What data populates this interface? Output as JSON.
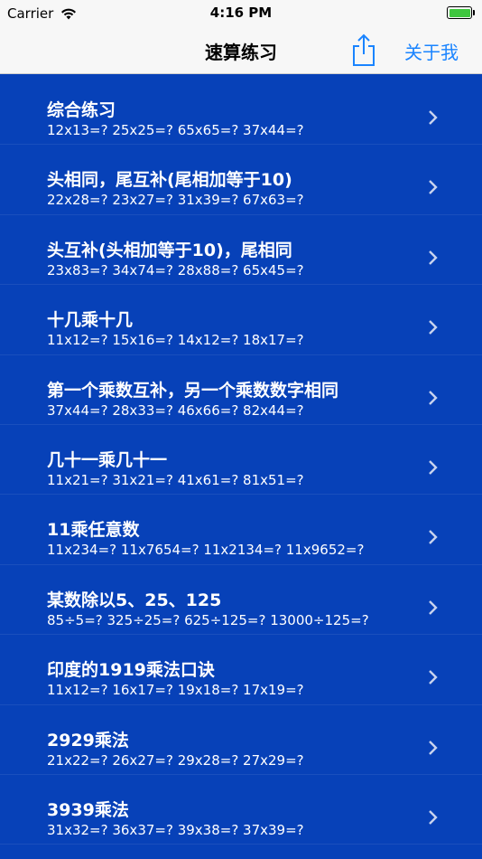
{
  "status": {
    "carrier": "Carrier",
    "time": "4:16 PM"
  },
  "nav": {
    "title": "速算练习",
    "about": "关于我"
  },
  "colors": {
    "background": "#0741b8",
    "accent": "#1a84ff",
    "navbar": "#f7f7f7"
  },
  "items": [
    {
      "title": "综合练习",
      "sub": "12x13=?  25x25=?  65x65=?  37x44=?"
    },
    {
      "title": "头相同，尾互补(尾相加等于10)",
      "sub": "22x28=?  23x27=?  31x39=?  67x63=?"
    },
    {
      "title": "头互补(头相加等于10)，尾相同",
      "sub": "23x83=?  34x74=?  28x88=?  65x45=?"
    },
    {
      "title": "十几乘十几",
      "sub": "11x12=?  15x16=?  14x12=?  18x17=?"
    },
    {
      "title": "第一个乘数互补，另一个乘数数字相同",
      "sub": "37x44=?  28x33=?  46x66=?  82x44=?"
    },
    {
      "title": "几十一乘几十一",
      "sub": "11x21=?  31x21=?  41x61=?  81x51=?"
    },
    {
      "title": "11乘任意数",
      "sub": "11x234=?  11x7654=?  11x2134=?  11x9652=?"
    },
    {
      "title": "某数除以5、25、125",
      "sub": "85÷5=?  325÷25=?  625÷125=?  13000÷125=?"
    },
    {
      "title": "印度的1919乘法口诀",
      "sub": "11x12=?  16x17=?  19x18=?  17x19=?"
    },
    {
      "title": "2929乘法",
      "sub": "21x22=?  26x27=?  29x28=?  27x29=?"
    },
    {
      "title": "3939乘法",
      "sub": "31x32=?  36x37=?  39x38=?  37x39=?"
    }
  ]
}
